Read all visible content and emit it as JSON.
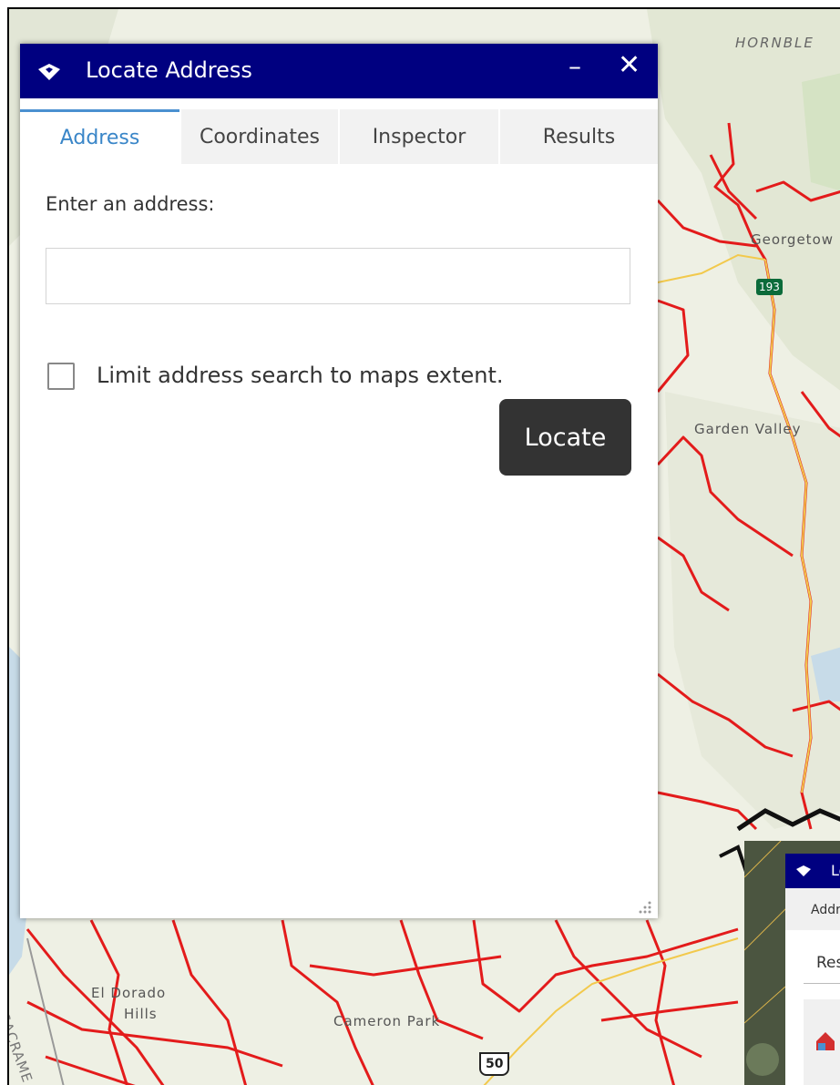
{
  "map": {
    "labels": {
      "hornbleak": "HORNBLE",
      "georgetown": "Georgetow",
      "highway_193": "193",
      "garden_valley": "Garden Valley",
      "el_dorado_hills_1": "El Dorado",
      "el_dorado_hills_2": "Hills",
      "cameron_park": "Cameron Park",
      "highway_50": "50",
      "sacramento": "SACRAME"
    }
  },
  "dialog": {
    "title": "Locate Address",
    "minimize_glyph": "–",
    "close_glyph": "✕",
    "tabs": [
      {
        "label": "Address",
        "active": true
      },
      {
        "label": "Coordinates",
        "active": false
      },
      {
        "label": "Inspector",
        "active": false
      },
      {
        "label": "Results",
        "active": false
      }
    ],
    "address_label": "Enter an address:",
    "address_value": "",
    "limit_checkbox_label": "Limit address search to maps extent.",
    "limit_checked": false,
    "locate_button": "Locate"
  },
  "background_dialog": {
    "title": "Lo",
    "tab": "Addre",
    "results_label": "Resu"
  },
  "colors": {
    "header": "#000080",
    "active_tab": "#3a86c8",
    "locate_button": "#333333",
    "road": "#e31b1b",
    "highway": "#f2c94c"
  }
}
